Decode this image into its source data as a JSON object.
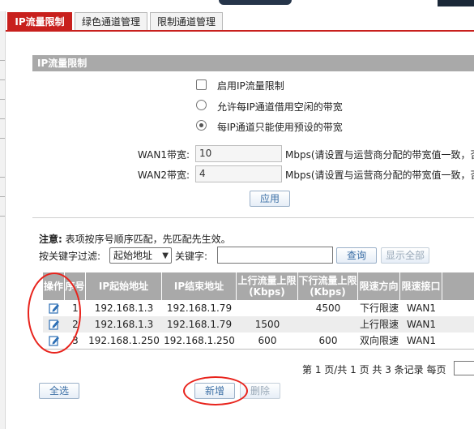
{
  "tabs": [
    {
      "label": "IP流量限制",
      "active": true
    },
    {
      "label": "绿色通道管理",
      "active": false
    },
    {
      "label": "限制通道管理",
      "active": false
    }
  ],
  "section": {
    "title": "IP流量限制"
  },
  "options": {
    "enable_label": "启用IP流量限制",
    "borrow_label": "允许每IP通道借用空闲的带宽",
    "preset_label": "每IP通道只能使用预设的带宽",
    "selected": "preset"
  },
  "wan1": {
    "label": "WAN1带宽:",
    "value": "10",
    "unit": "Mbps(请设置与运营商分配的带宽值一致，否"
  },
  "wan2": {
    "label": "WAN2带宽:",
    "value": "4",
    "unit": "Mbps(请设置与运营商分配的带宽值一致，否"
  },
  "apply_label": "应用",
  "note": {
    "prefix": "注意:",
    "text": "表项按序号顺序匹配，先匹配先生效。"
  },
  "filter": {
    "label": "按关键字过滤:",
    "select_value": "起始地址",
    "keyword_label": "关键字:",
    "keyword_value": "",
    "search_label": "查询",
    "show_all_label": "显示全部"
  },
  "table": {
    "headers": [
      "操作",
      "序号",
      "IP起始地址",
      "IP结束地址",
      "上行流量上限\n(Kbps)",
      "下行流量上限\n(Kbps)",
      "限速方向",
      "限速接口"
    ],
    "rows": [
      {
        "id": "1",
        "start": "192.168.1.3",
        "end": "192.168.1.79",
        "up": "",
        "down": "4500",
        "dir": "下行限速",
        "iface": "WAN1"
      },
      {
        "id": "2",
        "start": "192.168.1.3",
        "end": "192.168.1.79",
        "up": "1500",
        "down": "",
        "dir": "上行限速",
        "iface": "WAN1"
      },
      {
        "id": "3",
        "start": "192.168.1.250",
        "end": "192.168.1.250",
        "up": "600",
        "down": "600",
        "dir": "双向限速",
        "iface": "WAN1"
      }
    ]
  },
  "pager": {
    "text": "第 1 页/共 1 页 共 3 条记录 每页"
  },
  "buttons": {
    "select_all": "全选",
    "add": "新增",
    "delete": "删除"
  },
  "colors": {
    "accent": "#c8201d",
    "header_bg": "#a9a9a9",
    "highlight": "#e8231c"
  },
  "icons": {
    "edit": "edit-icon"
  }
}
